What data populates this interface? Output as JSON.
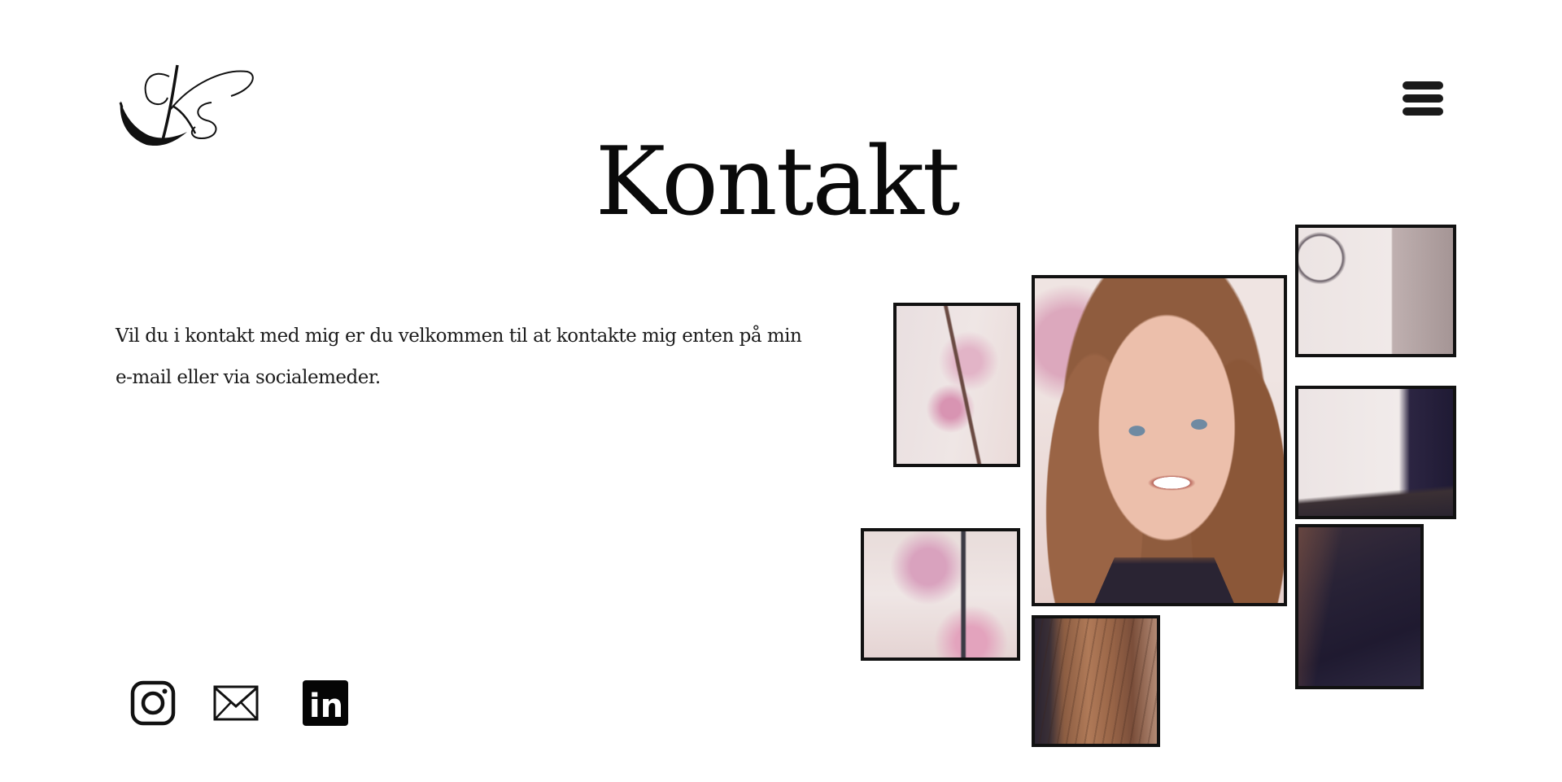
{
  "header": {
    "logo_text": "KS",
    "menu_icon": "hamburger-menu-icon"
  },
  "main": {
    "title": "Kontakt",
    "intro_line1": "Vil du i kontakt med mig er du velkommen til at kontakte  mig enten på min",
    "intro_line2": "e-mail eller via socialemeder."
  },
  "social": {
    "icons": [
      "instagram-icon",
      "mail-icon",
      "linkedin-icon"
    ],
    "linkedin_text": "in"
  },
  "gallery": {
    "frame_color": "#111111",
    "tones": {
      "blossom": "#eadbd9",
      "pink": "#dba7be",
      "hair": "#8a5a3e",
      "skin": "#e9b9a3",
      "dark": "#221d33"
    }
  }
}
